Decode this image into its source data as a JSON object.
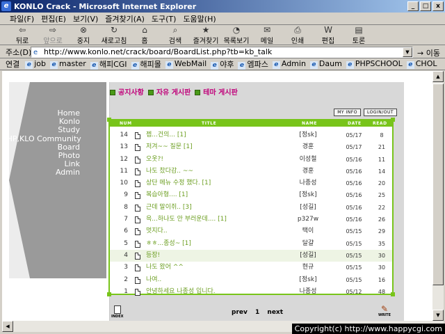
{
  "window": {
    "title": "KONLO Crack - Microsoft Internet Explorer",
    "min": "_",
    "max": "□",
    "close": "x"
  },
  "menubar": [
    "파일(F)",
    "편집(E)",
    "보기(V)",
    "즐겨찾기(A)",
    "도구(T)",
    "도움말(H)"
  ],
  "toolbar": {
    "back": "뒤로",
    "forward": "앞으로",
    "stop": "중지",
    "refresh": "새로고침",
    "home": "홈",
    "search": "검색",
    "favorites": "즐겨찾기",
    "history": "목록보기",
    "mail": "메일",
    "print": "인쇄",
    "edit": "편집",
    "discuss": "토론"
  },
  "address": {
    "label": "주소(D)",
    "url": "http://www.konlo.net/crack/board/BoardList.php?tb=kb_talk",
    "go": "이동"
  },
  "links": {
    "label": "연결",
    "items": [
      "job",
      "master",
      "해피CGI",
      "해피몰",
      "WebMail",
      "야후",
      "엠파스",
      "Admin",
      "Daum",
      "PHPSCHOOL",
      "CHOL"
    ]
  },
  "site_menu": [
    "Home",
    "Konlo",
    "Study",
    "PHP,KLO Community",
    "Board",
    "Photo",
    "Link",
    "Admin"
  ],
  "categories": [
    "공지사항",
    "자유 게시판",
    "테마 게시판"
  ],
  "mini_buttons": {
    "myinfo": "MY INFO",
    "logout": "LOGIN/OUT"
  },
  "table": {
    "headers": {
      "num": "NUM",
      "title": "TITLE",
      "name": "NAME",
      "date": "DATE",
      "read": "READ"
    },
    "rows": [
      {
        "num": "14",
        "title": "젭...건의... [1]",
        "name": "[정sk]",
        "date": "05/17",
        "read": "8"
      },
      {
        "num": "13",
        "title": "저겨~~ 질문 [1]",
        "name": "경훈",
        "date": "05/17",
        "read": "21"
      },
      {
        "num": "12",
        "title": "오옷?!",
        "name": "이성철",
        "date": "05/16",
        "read": "11"
      },
      {
        "num": "11",
        "title": "나도 찼다감.. ~~",
        "name": "경훈",
        "date": "05/16",
        "read": "14"
      },
      {
        "num": "10",
        "title": "상단 메뉴 수정 했다. [1]",
        "name": "나종성",
        "date": "05/16",
        "read": "20"
      },
      {
        "num": "9",
        "title": "복습아형.... [1]",
        "name": "[정sk]",
        "date": "05/16",
        "read": "25"
      },
      {
        "num": "8",
        "title": "근데 말이쥐.. [3]",
        "name": "[성길]",
        "date": "05/16",
        "read": "22"
      },
      {
        "num": "7",
        "title": "윽...하나도 안 부러운데.... [1]",
        "name": "p327w",
        "date": "05/16",
        "read": "26"
      },
      {
        "num": "6",
        "title": "멋지다..",
        "name": "택이",
        "date": "05/15",
        "read": "29"
      },
      {
        "num": "5",
        "title": "ㅎㅎ...종성~ [1]",
        "name": "달걀",
        "date": "05/15",
        "read": "35"
      },
      {
        "num": "4",
        "title": "등장!",
        "name": "[성길]",
        "date": "05/15",
        "read": "30"
      },
      {
        "num": "3",
        "title": "나도 왔어 ^^",
        "name": "현규",
        "date": "05/15",
        "read": "30"
      },
      {
        "num": "2",
        "title": "나여..",
        "name": "[정sk]",
        "date": "05/15",
        "read": "16"
      },
      {
        "num": "1",
        "title": "안녕하세요 나종성 입니다.",
        "name": "나종성",
        "date": "05/12",
        "read": "48"
      }
    ]
  },
  "footer": {
    "index": "INDEX",
    "prev": "prev",
    "page": "1",
    "next": "next",
    "write": "WRITE"
  },
  "copyright": "Copyright(c) http://www.happycgi.com",
  "colors": {
    "accent": "#78c41a",
    "title_text": "#6a9d1e",
    "category": "#c0007a"
  }
}
